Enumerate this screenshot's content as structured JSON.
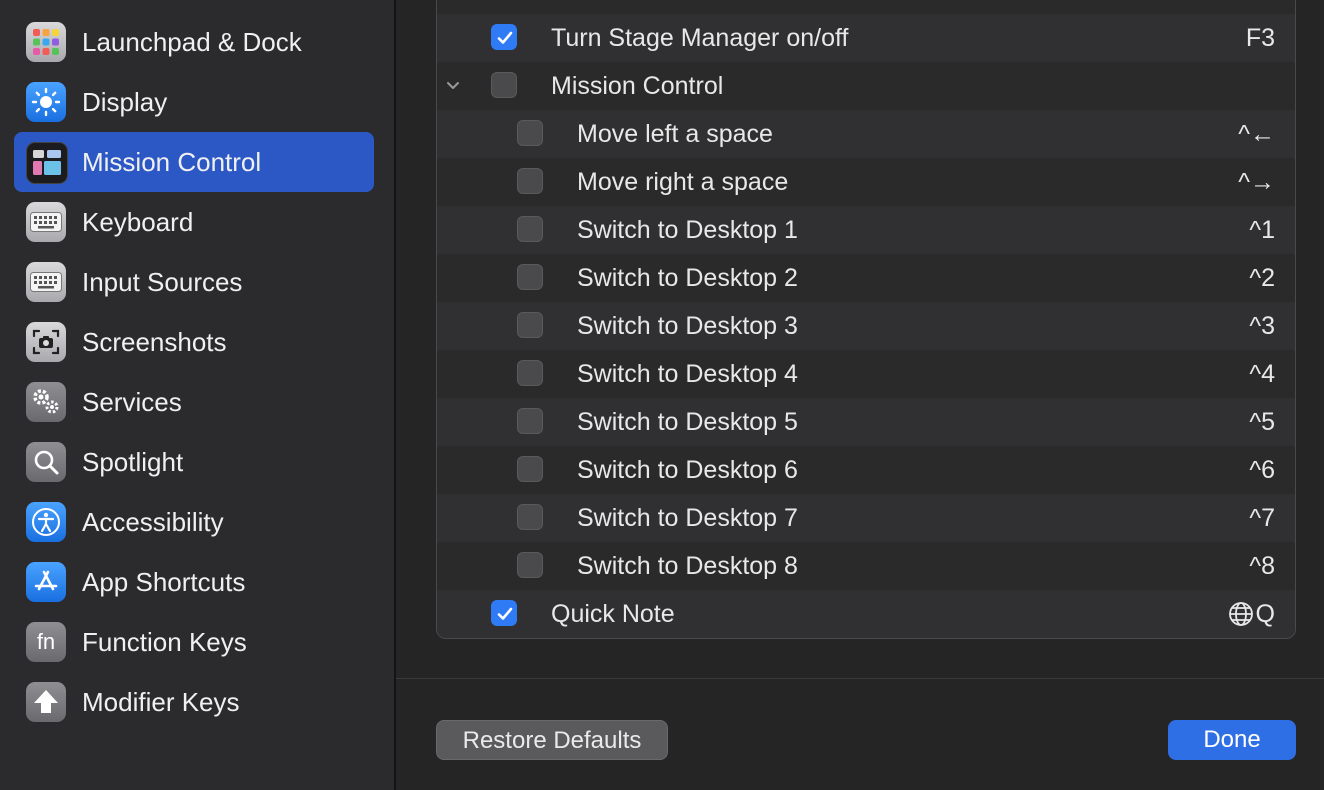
{
  "sidebar": {
    "items": [
      {
        "label": "Launchpad & Dock",
        "icon": "launchpad-icon"
      },
      {
        "label": "Display",
        "icon": "sun-icon"
      },
      {
        "label": "Mission Control",
        "icon": "mission-control-icon",
        "selected": true
      },
      {
        "label": "Keyboard",
        "icon": "keyboard-icon"
      },
      {
        "label": "Input Sources",
        "icon": "keyboard-icon"
      },
      {
        "label": "Screenshots",
        "icon": "camera-icon"
      },
      {
        "label": "Services",
        "icon": "gears-icon"
      },
      {
        "label": "Spotlight",
        "icon": "magnifier-icon"
      },
      {
        "label": "Accessibility",
        "icon": "accessibility-icon"
      },
      {
        "label": "App Shortcuts",
        "icon": "app-store-icon"
      },
      {
        "label": "Function Keys",
        "icon": "fn-icon"
      },
      {
        "label": "Modifier Keys",
        "icon": "up-arrow-icon"
      }
    ]
  },
  "shortcuts": [
    {
      "label": "Turn Stage Manager on/off",
      "key": "F3",
      "checked": true,
      "indent": 0
    },
    {
      "label": "Mission Control",
      "key": "",
      "checked": false,
      "indent": 0,
      "expanded": true
    },
    {
      "label": "Move left a space",
      "key": "^←",
      "checked": false,
      "indent": 1
    },
    {
      "label": "Move right a space",
      "key": "^→",
      "checked": false,
      "indent": 1
    },
    {
      "label": "Switch to Desktop 1",
      "key": "^1",
      "checked": false,
      "indent": 1
    },
    {
      "label": "Switch to Desktop 2",
      "key": "^2",
      "checked": false,
      "indent": 1
    },
    {
      "label": "Switch to Desktop 3",
      "key": "^3",
      "checked": false,
      "indent": 1
    },
    {
      "label": "Switch to Desktop 4",
      "key": "^4",
      "checked": false,
      "indent": 1
    },
    {
      "label": "Switch to Desktop 5",
      "key": "^5",
      "checked": false,
      "indent": 1
    },
    {
      "label": "Switch to Desktop 6",
      "key": "^6",
      "checked": false,
      "indent": 1
    },
    {
      "label": "Switch to Desktop 7",
      "key": "^7",
      "checked": false,
      "indent": 1
    },
    {
      "label": "Switch to Desktop 8",
      "key": "^8",
      "checked": false,
      "indent": 1
    },
    {
      "label": "Quick Note",
      "key": "Q",
      "key_icon": "globe-icon",
      "checked": true,
      "indent": 0
    }
  ],
  "buttons": {
    "restore": "Restore Defaults",
    "done": "Done"
  },
  "colors": {
    "accent": "#2f7bf5",
    "selection": "#2c58c5"
  }
}
